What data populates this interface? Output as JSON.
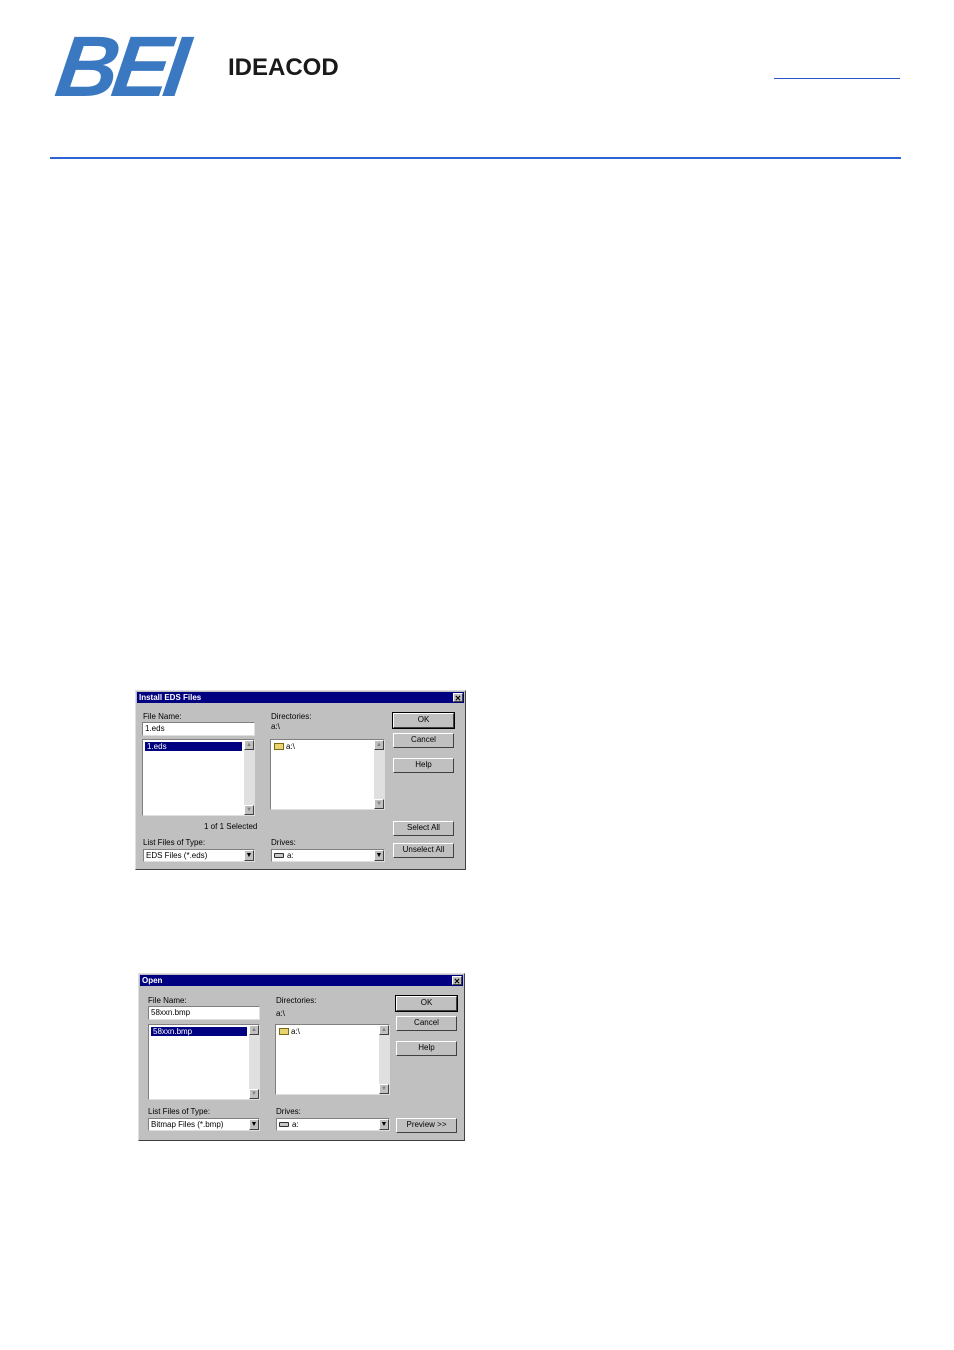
{
  "header": {
    "logo_mark": "BEI",
    "logo_text": "IDEACOD"
  },
  "dialog1": {
    "title": "Install EDS Files",
    "close_glyph": "✕",
    "file_name_label": "File Name:",
    "file_name_value": "1.eds",
    "files": [
      "1.eds"
    ],
    "directories_label": "Directories:",
    "current_dir": "a:\\",
    "dir_items": [
      "a:\\"
    ],
    "selected_count": "1 of 1 Selected",
    "file_type_label": "List Files of Type:",
    "file_type_value": "EDS Files (*.eds)",
    "drives_label": "Drives:",
    "drive_value": "a:",
    "buttons": {
      "ok": "OK",
      "cancel": "Cancel",
      "help": "Help",
      "select_all": "Select All",
      "unselect_all": "Unselect All"
    }
  },
  "dialog2": {
    "title": "Open",
    "close_glyph": "✕",
    "file_name_label": "File Name:",
    "file_name_value": "58xxn.bmp",
    "files": [
      "58xxn.bmp"
    ],
    "directories_label": "Directories:",
    "current_dir": "a:\\",
    "dir_items": [
      "a:\\"
    ],
    "file_type_label": "List Files of Type:",
    "file_type_value": "Bitmap Files (*.bmp)",
    "drives_label": "Drives:",
    "drive_value": "a:",
    "buttons": {
      "ok": "OK",
      "cancel": "Cancel",
      "help": "Help",
      "preview": "Preview >>"
    }
  },
  "icons": {
    "scroll_up": "▲",
    "scroll_down": "▼",
    "dropdown": "▼"
  }
}
